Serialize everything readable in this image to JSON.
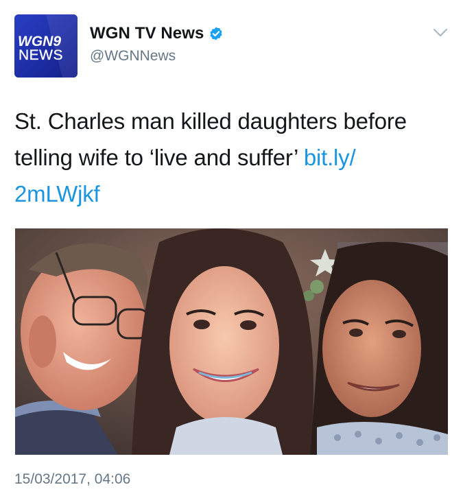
{
  "tweet": {
    "avatar": {
      "icon": "wgn9-news-logo",
      "logo_text_top": "WGN9",
      "logo_text_bottom": "NEWS",
      "brand_color": "#1c2fa8"
    },
    "display_name": "WGN TV News",
    "verified": true,
    "handle": "@WGNNews",
    "menu_icon": "chevron-down-icon",
    "text": "St. Charles man killed daughters before telling wife to ‘live and suffer’ ",
    "link_text": "bit.ly/\n2mLWjkf",
    "photo": {
      "icon": "family-selfie-photo"
    },
    "timestamp": "15/03/2017, 04:06"
  },
  "colors": {
    "link": "#1b95e0",
    "secondary_text": "#657786",
    "primary_text": "#14171a",
    "verified_badge": "#1da1f2"
  }
}
